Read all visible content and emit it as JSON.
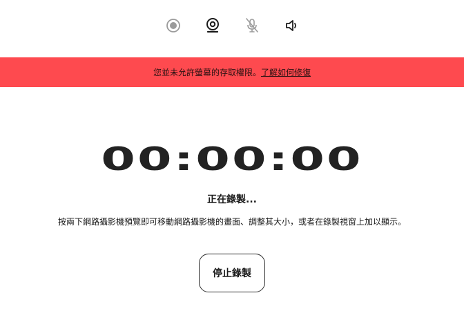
{
  "toolbar": {
    "buttons": [
      {
        "icon": "record-screen-icon",
        "state": "disabled"
      },
      {
        "icon": "webcam-icon",
        "state": "active"
      },
      {
        "icon": "microphone-muted-icon",
        "state": "disabled"
      },
      {
        "icon": "speaker-icon",
        "state": "active"
      }
    ]
  },
  "banner": {
    "message": "您並未允許螢幕的存取權限。",
    "link_label": "了解如何修復",
    "color": "#fe4a4f"
  },
  "recorder": {
    "timer": "00:00:00",
    "status": "正在錄製...",
    "hint": "按兩下網路攝影機預覽即可移動網路攝影機的畫面、調整其大小，或者在錄製視窗上加以顯示。",
    "stop_label": "停止錄製"
  }
}
